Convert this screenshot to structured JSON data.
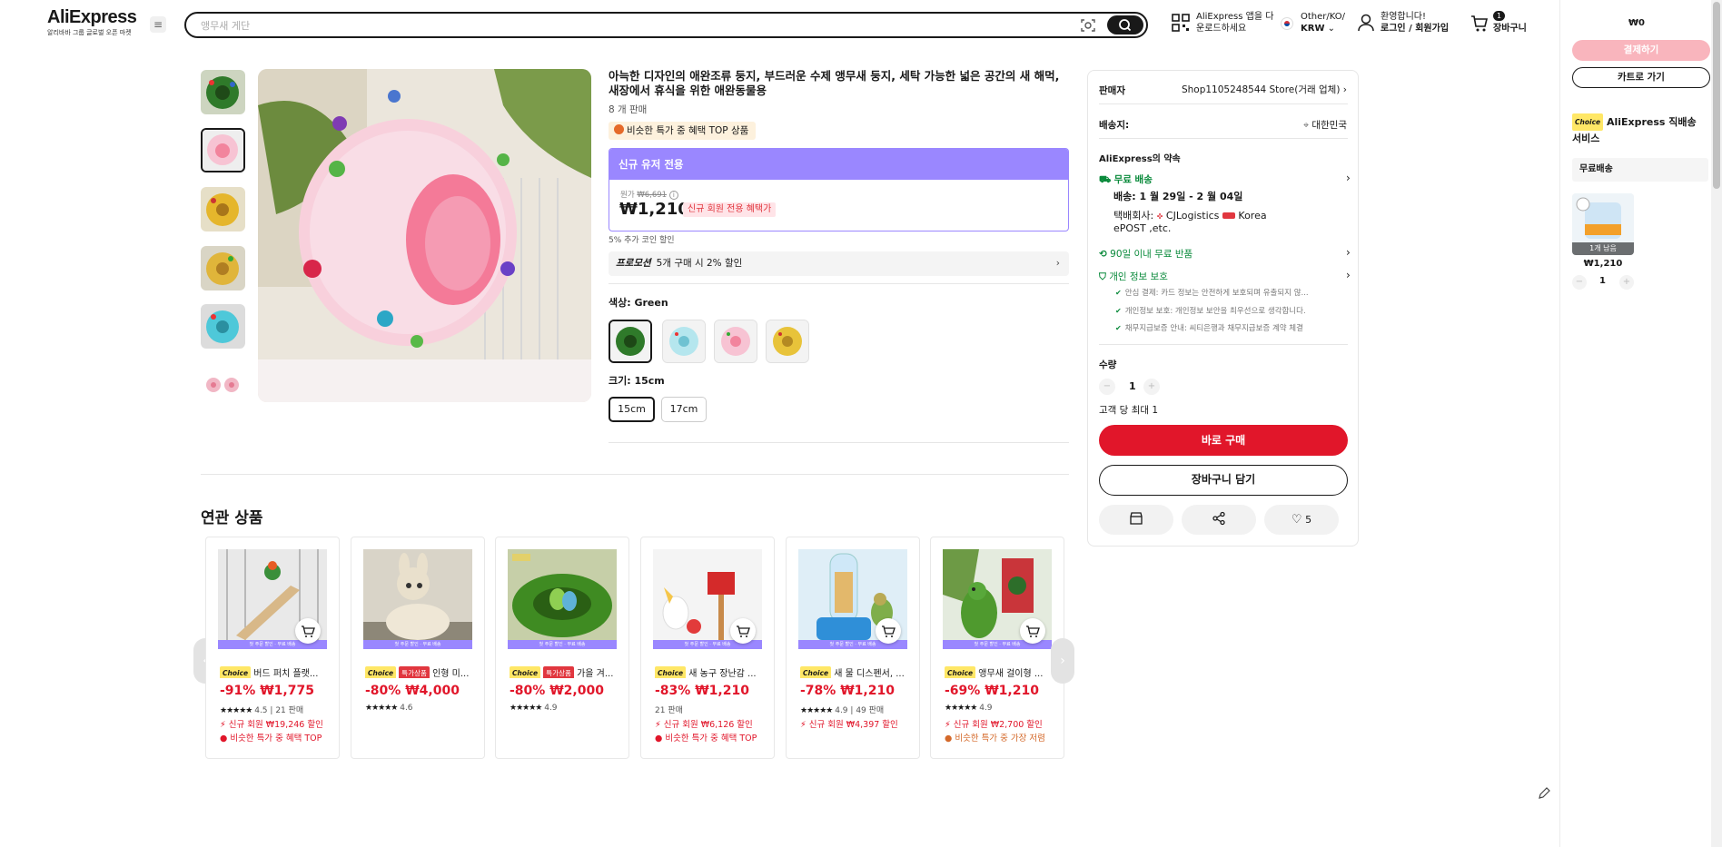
{
  "header": {
    "logo": "AliExpress",
    "logo_sub": "알리바바 그룹 글로벌 오픈 마켓",
    "search_placeholder": "앵무새 게단",
    "app": [
      "AliExpress 앱을 다",
      "운로드하세요"
    ],
    "locale": [
      "Other/KO/",
      "KRW"
    ],
    "account": [
      "환영합니다!",
      "로그인 / 회원가입"
    ],
    "cart_count": "1",
    "cart_label": "장바구니"
  },
  "product": {
    "title": "아늑한 디자인의 애완조류 둥지, 부드러운 수제 앵무새 둥지, 세탁 가능한 넓은 공간의 새 해먹, 새장에서 휴식을 위한 애완동물용",
    "sold": "8 개 판매",
    "top_badge": "비슷한 특가 중 혜택 TOP 상품",
    "new_user_header": "신규 유저 전용",
    "original_label": "원가",
    "original_price": "₩6,691",
    "price": "₩1,210",
    "new_user_tag": "신규 회원 전용 혜택가",
    "coin": "5% 추가 코인 할인",
    "promo_label": "프로모션",
    "promo_text": "5개 구매 시 2% 할인",
    "color_label": "색상: Green",
    "size_label": "크기: 15cm",
    "sizes": [
      "15cm",
      "17cm"
    ]
  },
  "buybox": {
    "seller_label": "판매자",
    "seller": "Shop1105248544 Store(거래 업체)",
    "ship_to_label": "배송지:",
    "ship_to": "대한민국",
    "promise": "AliExpress의 약속",
    "free_ship": "무료 배송",
    "delivery": "배송: 1 월 29일 - 2 월 04일",
    "courier_label": "택배회사:",
    "courier1": "CJLogistics",
    "courier2": "Korea",
    "courier3": "ePOST ,etc.",
    "returns": "90일 이내 무료 반품",
    "privacy": "개인 정보 보호",
    "privacy_items": [
      "안심 결제: 카드 정보는 안전하게 보호되며 유출되지 않...",
      "개인정보 보호: 개인정보 보안을 최우선으로 생각합니다.",
      "채무지급보증 안내: 씨티은행과 채무지급보증 계약 체결"
    ],
    "qty_label": "수량",
    "qty": "1",
    "limit": "고객 당 최대 1",
    "buy_now": "바로 구매",
    "add_cart": "장바구니 담기",
    "wish_count": "5"
  },
  "related": {
    "title": "연관 상품",
    "strip": "첫 주문 할인 · 무료 배송",
    "items": [
      {
        "tag": "",
        "title": "버드 퍼치 플랫...",
        "discount": "-91%",
        "price": "₩1,775",
        "rating": "4.5",
        "sold": "21 판매",
        "line2": "신규 회원 ₩19,246 할인",
        "line3": "비슷한 특가 중 혜택 TOP"
      },
      {
        "tag": "특가상품",
        "title": "인형 미...",
        "discount": "-80%",
        "price": "₩4,000",
        "rating": "4.6",
        "sold": "",
        "line2": "",
        "line3": ""
      },
      {
        "tag": "특가상품",
        "title": "가을 겨...",
        "discount": "-80%",
        "price": "₩2,000",
        "rating": "4.9",
        "sold": "",
        "line2": "",
        "line3": ""
      },
      {
        "tag": "",
        "title": "새 농구 장난감 ...",
        "discount": "-83%",
        "price": "₩1,210",
        "rating": "",
        "sold": "21 판매",
        "line2": "신규 회원 ₩6,126 할인",
        "line3": "비슷한 특가 중 혜택 TOP"
      },
      {
        "tag": "",
        "title": "새 물 디스펜서, ...",
        "discount": "-78%",
        "price": "₩1,210",
        "rating": "4.9",
        "sold": "49 판매",
        "line2": "신규 회원 ₩4,397 할인",
        "line3": ""
      },
      {
        "tag": "",
        "title": "앵무새 걸이형 ...",
        "discount": "-69%",
        "price": "₩1,210",
        "rating": "4.9",
        "sold": "",
        "line2": "신규 회원 ₩2,700 할인",
        "line3": "비슷한 특가 중 가장 저렴"
      }
    ]
  },
  "sidebar": {
    "total": "₩0",
    "checkout": "결제하기",
    "go_cart": "카트로 가기",
    "choice": "Choice",
    "service": "AliExpress 직배송 서비스",
    "free_ship": "무료배송",
    "remaining": "1개 남음",
    "item_price": "₩1,210",
    "item_qty": "1"
  },
  "colors": {
    "accent_red": "#e1162a",
    "choice_purple": "#9a87ff",
    "green": "#0a8a3b"
  }
}
